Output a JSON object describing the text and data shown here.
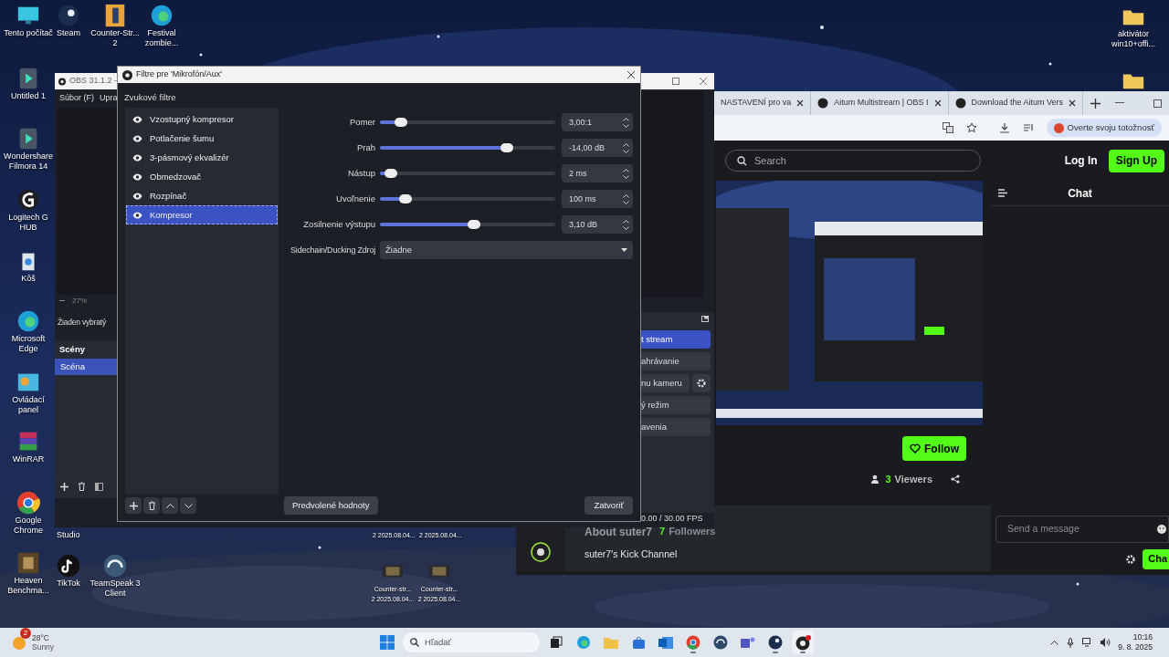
{
  "desktop": {
    "left_column": [
      {
        "kind": "monitor",
        "lines": [
          "Tento počítač"
        ]
      },
      {
        "kind": "filmora",
        "lines": [
          "Untitled 1"
        ]
      },
      {
        "kind": "filmora",
        "lines": [
          "Wondershare",
          "Filmora 14"
        ]
      },
      {
        "kind": "logitech",
        "lines": [
          "Logitech G",
          "HUB"
        ]
      },
      {
        "kind": "bin",
        "lines": [
          "Kôš"
        ]
      },
      {
        "kind": "edge",
        "lines": [
          "Microsoft",
          "Edge"
        ]
      },
      {
        "kind": "control",
        "lines": [
          "Ovládací",
          "panel"
        ]
      },
      {
        "kind": "winrar",
        "lines": [
          "WinRAR"
        ]
      },
      {
        "kind": "chrome",
        "lines": [
          "Google",
          "Chrome"
        ]
      },
      {
        "kind": "heaven",
        "lines": [
          "Heaven",
          "Benchma..."
        ]
      }
    ],
    "top_row": [
      {
        "kind": "steam",
        "lines": [
          "Steam"
        ]
      },
      {
        "kind": "cs",
        "lines": [
          "Counter-Str...",
          "2"
        ]
      },
      {
        "kind": "edge",
        "lines": [
          "Festival",
          "zombie..."
        ]
      }
    ],
    "bottom_row": [
      {
        "kind": "tiktok",
        "lines": [
          "TikTok"
        ]
      },
      {
        "kind": "teamspeak",
        "lines": [
          "TeamSpeak 3",
          "Client"
        ]
      }
    ],
    "partial_label": "Studio",
    "right_column": [
      {
        "kind": "folder",
        "lines": [
          "aktivátor",
          "win10+offi..."
        ]
      },
      {
        "kind": "folder"
      }
    ],
    "files": [
      {
        "kind": "video",
        "lines": [
          "Counter-str...",
          "2 2025.08.04..."
        ]
      },
      {
        "kind": "video",
        "lines": [
          "Counter-str...",
          "2 2025.08.04..."
        ]
      }
    ],
    "hidden_file_labels": [
      "2 2025.08.04...",
      "2 2025.08.04..."
    ]
  },
  "browser": {
    "tabs": [
      {
        "title": "NASTAVENÍ pro va"
      },
      {
        "title": "Aitum Multistream | OBS I"
      },
      {
        "title": "Download the Aitum Vers"
      }
    ],
    "profile_button": "Overte svoju totožnosť",
    "page": {
      "search": {
        "placeholder": "Search"
      },
      "login": "Log In",
      "signup": "Sign Up",
      "chat_title": "Chat",
      "follow": "Follow",
      "viewers_count": "3",
      "viewers_label": "Viewers",
      "about_title": "About suter7",
      "followers_count": "7",
      "followers_label": "Followers",
      "channel_description": "suter7's Kick Channel",
      "message": {
        "placeholder": "Send a message"
      },
      "chat_button": "Cha"
    }
  },
  "obs": {
    "title": "OBS 31.1.2 -",
    "menu": [
      "Súbor (F)",
      "Upra"
    ],
    "zoom": "27%",
    "selection": "Žiaden vybratý",
    "scenes_title": "Scény",
    "scenes": [
      {
        "name": "Scéna",
        "selected": true
      }
    ],
    "controls": [
      {
        "label": "t stream",
        "selected": true
      },
      {
        "label": "ahrávanie",
        "selected": false
      },
      {
        "label": "nu kameru",
        "selected": false
      },
      {
        "label": "ý režim",
        "selected": false
      },
      {
        "label": "avenia",
        "selected": false
      }
    ],
    "fps": "0.00 / 30.00 FPS"
  },
  "dialog": {
    "title": "Filtre pre 'Mikrofón/Aux'",
    "section": "Zvukové filtre",
    "filters": [
      {
        "name": "Vzostupný kompresor",
        "selected": false
      },
      {
        "name": "Potlačenie šumu",
        "selected": false
      },
      {
        "name": "3-pásmový ekvalizér",
        "selected": false
      },
      {
        "name": "Obmedzovač",
        "selected": false
      },
      {
        "name": "Rozpínač",
        "selected": false
      },
      {
        "name": "Kompresor",
        "selected": true
      }
    ],
    "params": [
      {
        "label": "Pomer",
        "level": 0.09,
        "value": "3,00:1"
      },
      {
        "label": "Prah",
        "level": 0.74,
        "value": "-14,00 dB"
      },
      {
        "label": "Nástup",
        "level": 0.03,
        "value": "2 ms"
      },
      {
        "label": "Uvoľnenie",
        "level": 0.12,
        "value": "100 ms"
      },
      {
        "label": "Zosilnenie výstupu",
        "level": 0.54,
        "value": "3,10 dB"
      }
    ],
    "sidechain": {
      "label": "Sidechain/Ducking Zdroj",
      "value": "Žiadne"
    },
    "defaults_button": "Predvolené hodnoty",
    "close_button": "Zatvoriť"
  },
  "taskbar": {
    "weather": {
      "badge": "2",
      "temperature": "28°C",
      "condition": "Sunny"
    },
    "search": {
      "placeholder": "Hľadať"
    },
    "apps": [
      {
        "kind": "taskview",
        "running": false
      },
      {
        "kind": "edge",
        "running": false
      },
      {
        "kind": "folder",
        "running": false
      },
      {
        "kind": "store",
        "running": false
      },
      {
        "kind": "outlook",
        "running": false
      },
      {
        "kind": "chrome",
        "running": true
      },
      {
        "kind": "headset",
        "running": false
      },
      {
        "kind": "teams",
        "running": false
      },
      {
        "kind": "steam",
        "running": true
      },
      {
        "kind": "obs",
        "running": true
      }
    ],
    "clock": {
      "time": "10:16",
      "date": "9. 8. 2025"
    }
  }
}
